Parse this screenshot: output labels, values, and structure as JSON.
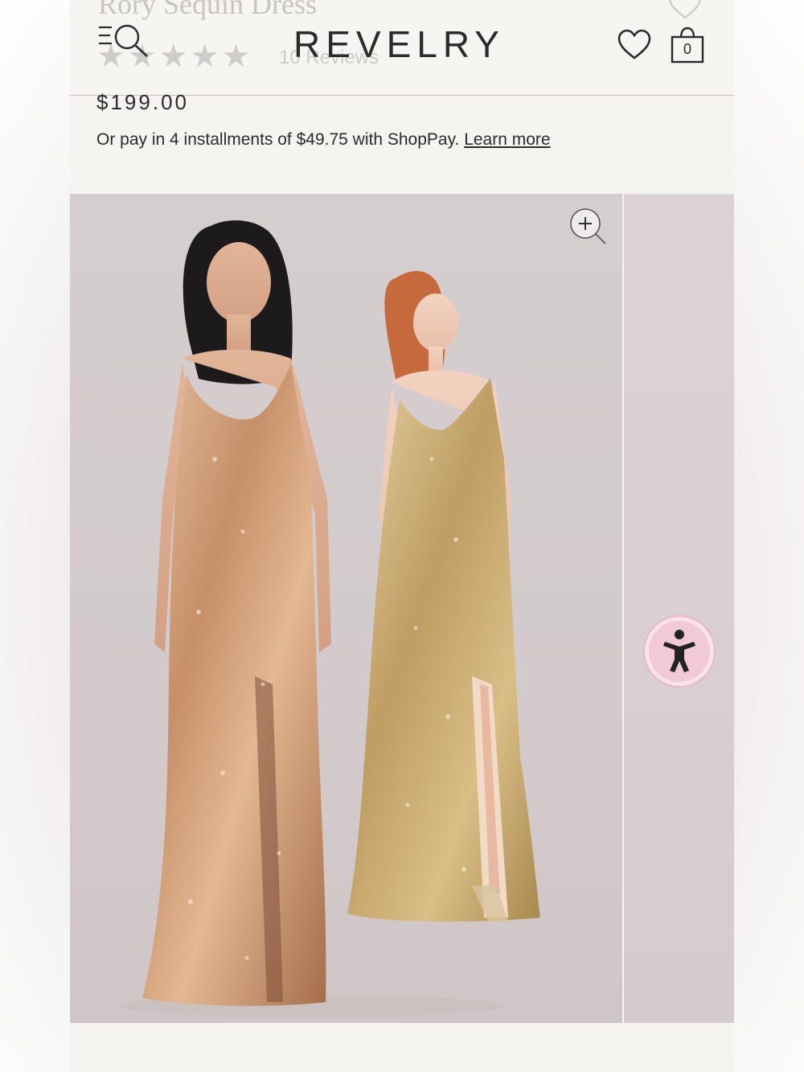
{
  "header": {
    "brand": "REVELRY",
    "bag_count": "0",
    "ghost_title": "Rory Sequin Dress",
    "ghost_reviews": "10 Reviews",
    "rating": 5
  },
  "product": {
    "price": "$199.00",
    "installments_text": "Or pay in 4 installments of $49.75 with ShopPay.",
    "learn_more": "Learn more"
  },
  "icons": {
    "menu": "menu-search-icon",
    "wishlist": "heart-icon",
    "bag": "shopping-bag-icon",
    "zoom": "zoom-in-icon",
    "accessibility": "accessibility-icon"
  },
  "colors": {
    "background": "#f6f4f1",
    "divider": "#d9b9b5",
    "accessibility_bg": "#f2c9d6",
    "dress_rose_gold": "#c9946a",
    "dress_gold": "#c9ad74"
  }
}
